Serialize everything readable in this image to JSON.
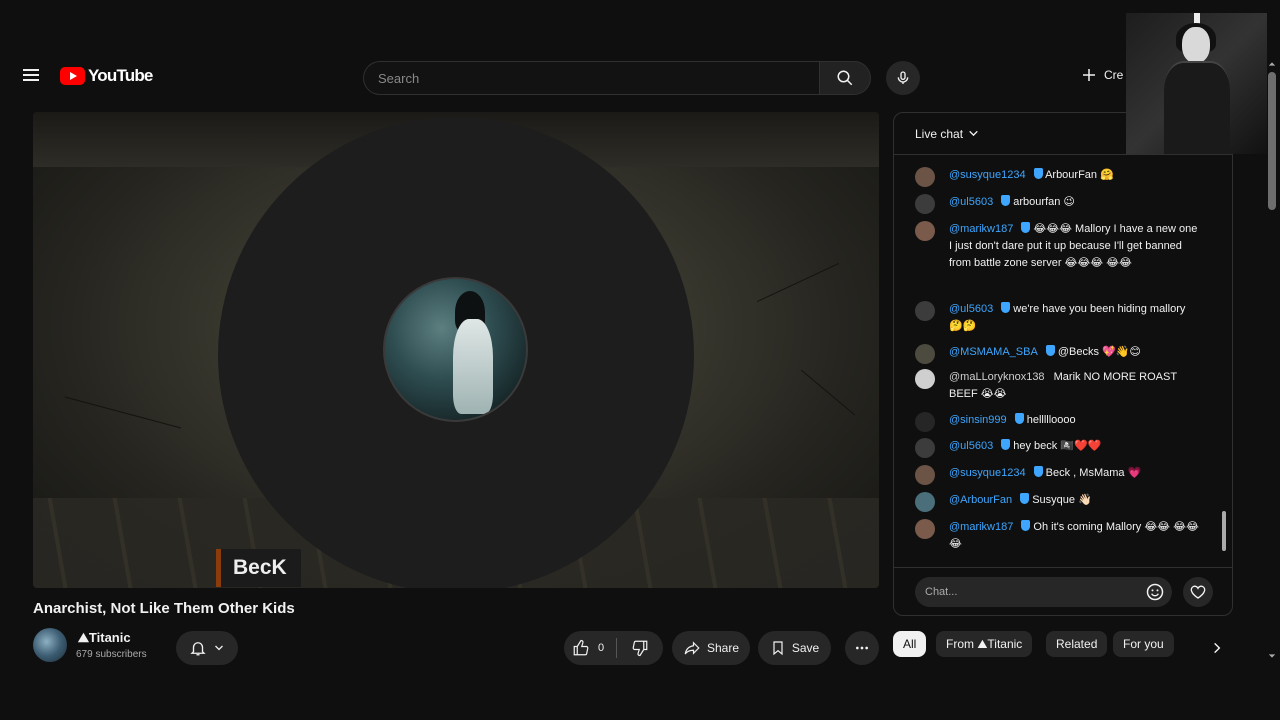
{
  "header": {
    "logo_text": "YouTube",
    "search_placeholder": "Search",
    "create_label": "Cre"
  },
  "video": {
    "overlay_name": "BecK",
    "title": "Anarchist, Not Like Them Other Kids"
  },
  "channel": {
    "name": "⛰Titanic",
    "subscribers": "679 subscribers"
  },
  "actions": {
    "like_count": "0",
    "share_label": "Share",
    "save_label": "Save"
  },
  "chat": {
    "header_label": "Live chat",
    "input_placeholder": "Chat...",
    "messages": [
      {
        "user": "@susyque1234",
        "text": "ArbourFan 🤗",
        "avatar_color": "#6b5346"
      },
      {
        "user": "@ul5603",
        "text": "arbourfan 😉",
        "avatar_color": "#3c3c3c"
      },
      {
        "user": "@marikw187",
        "text": "😂😂😂 Mallory I have a new one I just don't dare put it up because I'll get banned from battle zone server 😂😂😂 😂😂",
        "avatar_color": "#7a5a4a"
      },
      {
        "user": "@ul5603",
        "text": "we're have you been hiding mallory 🤔🤔",
        "avatar_color": "#3c3c3c"
      },
      {
        "user": "@MSMAMA_SBA",
        "text": "@Becks 💖👋😊",
        "avatar_color": "#4d4b3f"
      },
      {
        "user": "@maLLoryknox138",
        "text": "Marik NO MORE ROAST BEEF 😭😭",
        "avatar_color": "#cfcfcf"
      },
      {
        "user": "@sinsin999",
        "text": "hellllloooo",
        "avatar_color": "#262626"
      },
      {
        "user": "@ul5603",
        "text": "hey beck 🏴‍☠️❤️❤️",
        "avatar_color": "#3c3c3c"
      },
      {
        "user": "@susyque1234",
        "text": "Beck , MsMama 💗",
        "avatar_color": "#6b5346"
      },
      {
        "user": "@ArbourFan",
        "text": "Susyque 👋🏻",
        "avatar_color": "#4b6f7a"
      },
      {
        "user": "@marikw187",
        "text": "Oh it's coming Mallory 😂😂 😂😂😂",
        "avatar_color": "#7a5a4a"
      }
    ]
  },
  "chips": [
    "All",
    "From ⛰Titanic",
    "Related",
    "For you"
  ],
  "colors": {
    "background": "#0f0f0f",
    "surface": "#272727",
    "brand_red": "#ff0000",
    "username_blue": "#3ea6ff"
  }
}
